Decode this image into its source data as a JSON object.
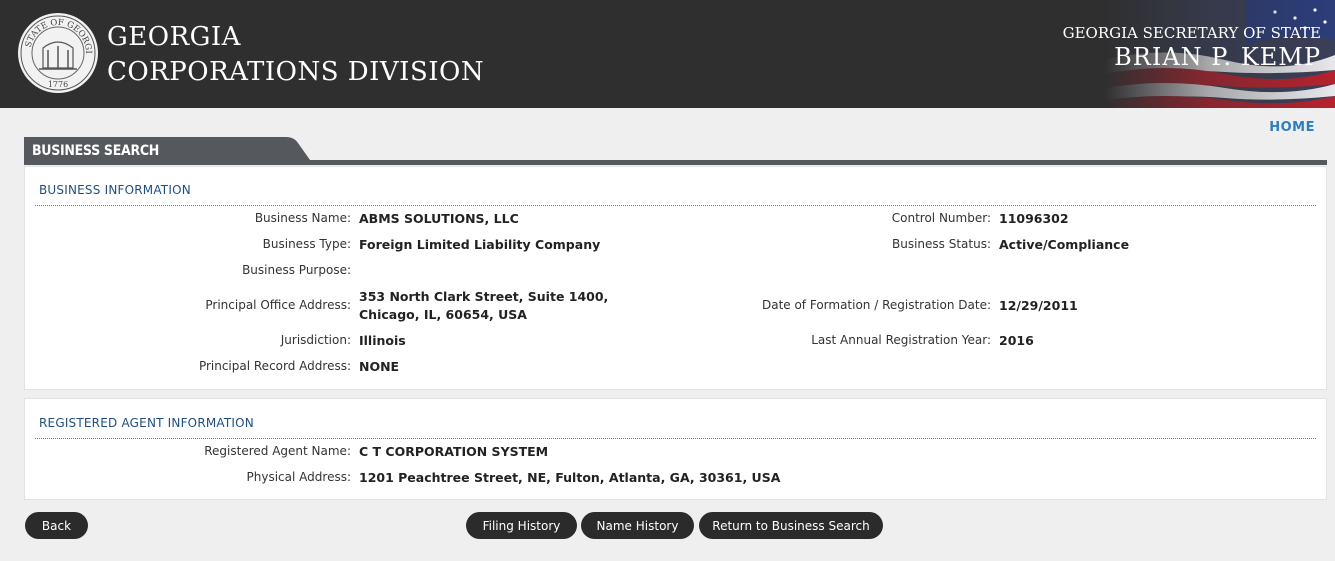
{
  "header": {
    "title_line1": "GEORGIA",
    "title_line2": "CORPORATIONS DIVISION",
    "seal_text_top": "STATE OF GEORGIA",
    "seal_year": "1776",
    "sos_line1": "GEORGIA SECRETARY OF STATE",
    "sos_line2": "BRIAN P. KEMP",
    "home_label": "HOME"
  },
  "section_tab": "BUSINESS SEARCH",
  "business_info": {
    "title": "BUSINESS INFORMATION",
    "left": [
      {
        "label": "Business Name:",
        "value": "ABMS SOLUTIONS, LLC"
      },
      {
        "label": "Business Type:",
        "value": "Foreign Limited Liability Company"
      },
      {
        "label": "Business Purpose:",
        "value": ""
      },
      {
        "label": "Principal Office Address:",
        "value_line1": "353 North Clark Street, Suite 1400,",
        "value_line2": "Chicago, IL, 60654, USA"
      },
      {
        "label": "Jurisdiction:",
        "value": "Illinois"
      },
      {
        "label": "Principal Record Address:",
        "value": "NONE"
      }
    ],
    "right": [
      {
        "label": "Control Number:",
        "value": "11096302"
      },
      {
        "label": "Business Status:",
        "value": "Active/Compliance"
      },
      {
        "label": "Date of Formation / Registration Date:",
        "value": "12/29/2011"
      },
      {
        "label": "Last Annual Registration Year:",
        "value": "2016"
      }
    ]
  },
  "agent_info": {
    "title": "REGISTERED AGENT INFORMATION",
    "rows": [
      {
        "label": "Registered Agent Name:",
        "value": "C T CORPORATION SYSTEM"
      },
      {
        "label": "Physical Address:",
        "value": "1201 Peachtree Street, NE, Fulton, Atlanta, GA, 30361, USA"
      }
    ]
  },
  "buttons": {
    "back": "Back",
    "filing_history": "Filing History",
    "name_history": "Name History",
    "return_search": "Return to Business Search"
  },
  "colors": {
    "header_bg": "#2f2f30",
    "link_blue": "#2b7ec3",
    "panel_title": "#1f4f82",
    "button_bg": "#2b2b2b"
  }
}
